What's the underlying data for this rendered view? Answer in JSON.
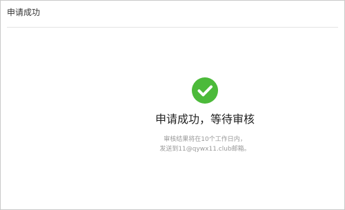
{
  "header": {
    "title": "申请成功"
  },
  "status": {
    "icon": "check-circle-icon",
    "icon_color": "#4cba3a",
    "title": "申请成功，等待审核"
  },
  "message": {
    "line1": "审核结果将在10个工作日内，",
    "line2": "发送到11@qywx11.club邮箱。"
  }
}
